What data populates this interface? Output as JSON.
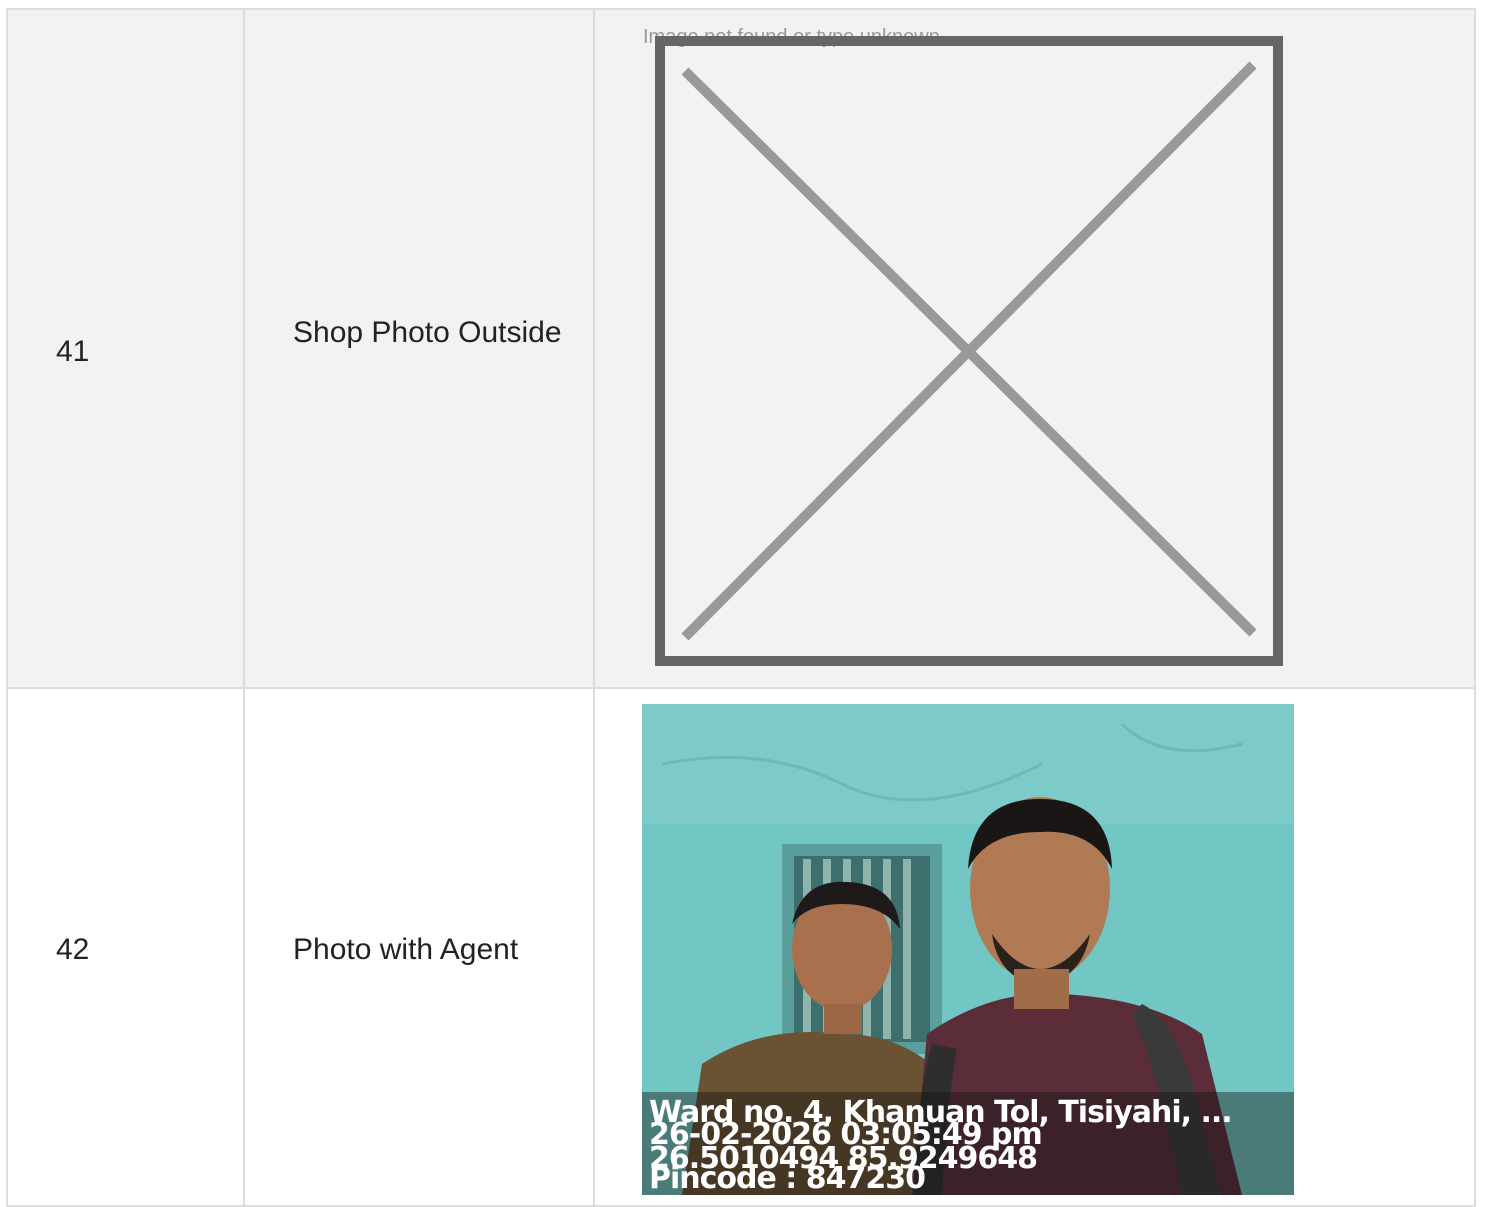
{
  "rows": [
    {
      "number": "41",
      "label": "Shop Photo Outside",
      "image": {
        "status": "broken",
        "alt_text": "Image not found or type unknown",
        "icon": "broken-image-x-icon"
      }
    },
    {
      "number": "42",
      "label": "Photo with Agent",
      "image": {
        "status": "photo",
        "stamp": {
          "address": "Ward no. 4, Khanuan Tol, Tisiyahi, ...",
          "datetime": "26-02-2026 03:05:49 pm",
          "coordinates": "26.5010494 85.9249648",
          "pincode": "Pincode : 847230"
        }
      }
    }
  ],
  "colors": {
    "border": "#dcdcdc",
    "shaded_row": "#f2f2f2",
    "broken_frame": "#666666",
    "broken_cross": "#999999",
    "wall": "#6fc3c1"
  }
}
